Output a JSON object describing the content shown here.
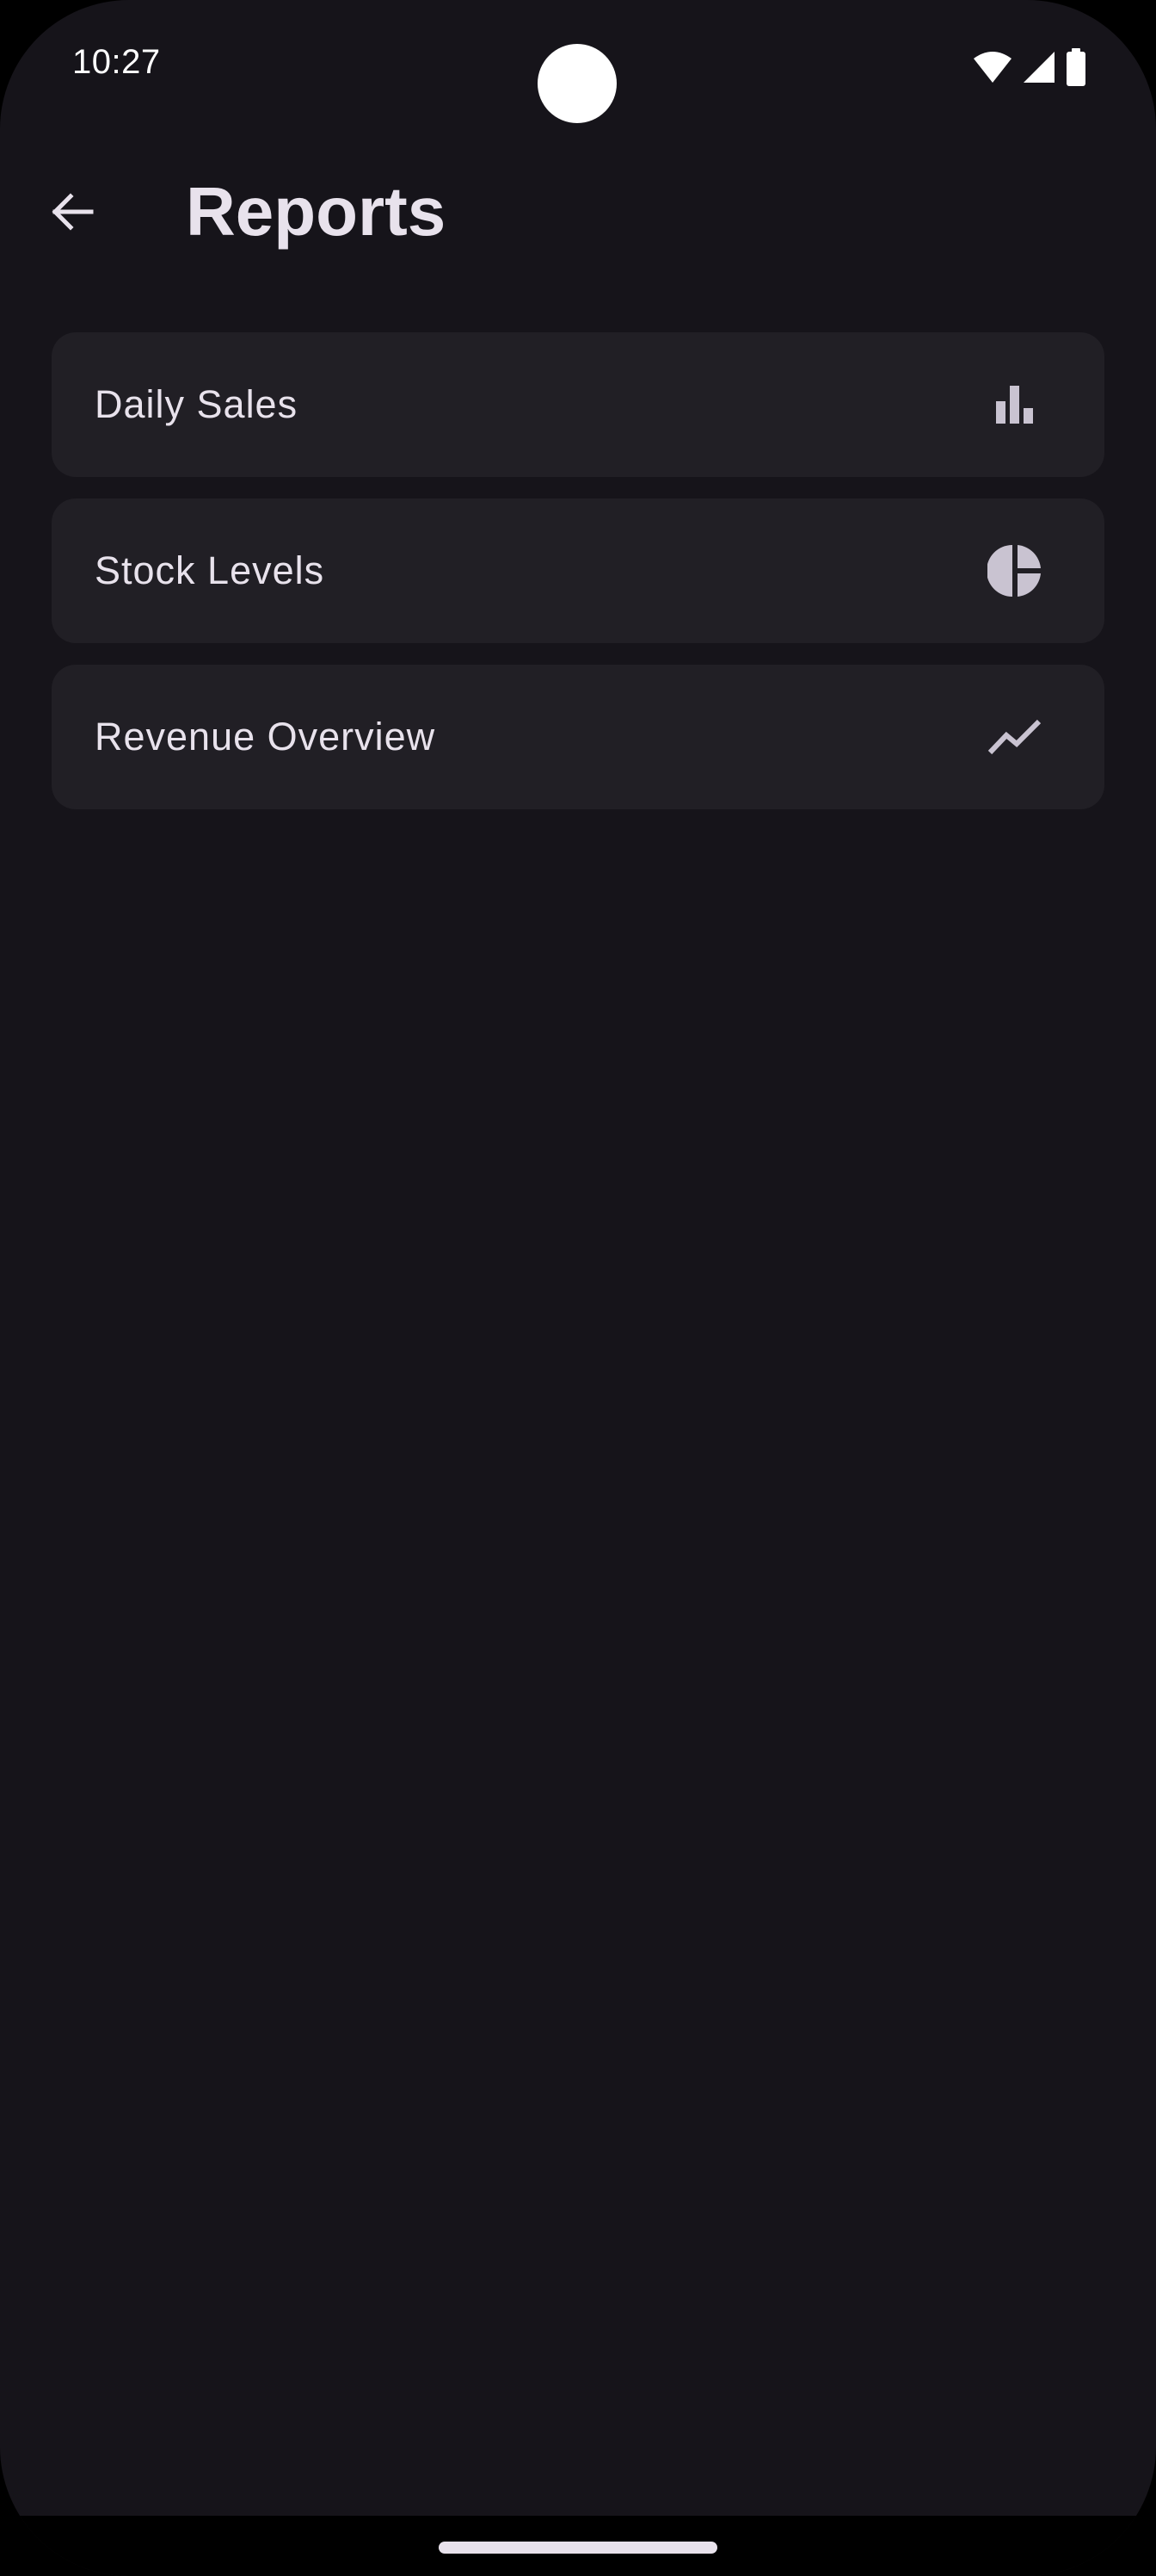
{
  "status_bar": {
    "time": "10:27"
  },
  "app_bar": {
    "title": "Reports",
    "back_icon": "arrow-back-icon"
  },
  "reports": [
    {
      "label": "Daily Sales",
      "icon": "bar-chart-icon"
    },
    {
      "label": "Stock Levels",
      "icon": "pie-chart-icon"
    },
    {
      "label": "Revenue Overview",
      "icon": "trend-line-icon"
    }
  ],
  "colors": {
    "background": "#16141a",
    "card": "#211f25",
    "text": "#e8e2ec",
    "icon": "#c9c3d1"
  }
}
